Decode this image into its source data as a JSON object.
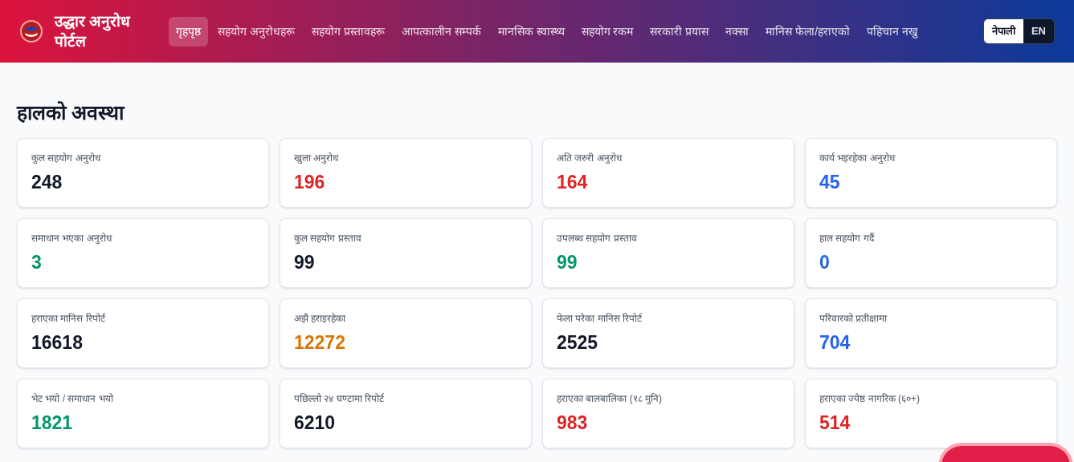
{
  "header": {
    "title": "उद्धार अनुरोध पोर्टल",
    "nav": [
      {
        "label": "गृहपृष्ठ",
        "selected": true
      },
      {
        "label": "सहयोग अनुरोधहरू",
        "selected": false
      },
      {
        "label": "सहयोग प्रस्तावहरू",
        "selected": false
      },
      {
        "label": "आपत्कालीन सम्पर्क",
        "selected": false
      },
      {
        "label": "मानसिक स्वास्थ्य",
        "selected": false
      },
      {
        "label": "सहयोग रकम",
        "selected": false
      },
      {
        "label": "सरकारी प्रयास",
        "selected": false
      },
      {
        "label": "नक्सा",
        "selected": false
      },
      {
        "label": "मानिस फेला/हराएको",
        "selected": false
      },
      {
        "label": "पहिचान नखु",
        "selected": false
      }
    ],
    "languages": [
      {
        "label": "नेपाली",
        "selected": true
      },
      {
        "label": "EN",
        "selected": false
      }
    ]
  },
  "section_title": "हालको अवस्था",
  "stats": [
    {
      "label": "कुल सहयोग अनुरोध",
      "value": "248",
      "color": "#111827"
    },
    {
      "label": "खुला अनुरोध",
      "value": "196",
      "color": "#dc2626"
    },
    {
      "label": "अति जरुरी अनुरोध",
      "value": "164",
      "color": "#dc2626"
    },
    {
      "label": "कार्य भइरहेका अनुरोध",
      "value": "45",
      "color": "#2563eb"
    },
    {
      "label": "समाधान भएका अनुरोध",
      "value": "3",
      "color": "#059669"
    },
    {
      "label": "कुल सहयोग प्रस्ताव",
      "value": "99",
      "color": "#111827"
    },
    {
      "label": "उपलब्ध सहयोग प्रस्ताव",
      "value": "99",
      "color": "#059669"
    },
    {
      "label": "हाल सहयोग गर्दै",
      "value": "0",
      "color": "#2563eb"
    },
    {
      "label": "हराएका मानिस रिपोर्ट",
      "value": "16618",
      "color": "#111827"
    },
    {
      "label": "अझै हराइरहेका",
      "value": "12272",
      "color": "#d97706"
    },
    {
      "label": "फेला परेका मानिस रिपोर्ट",
      "value": "2525",
      "color": "#111827"
    },
    {
      "label": "परिवारको प्रतीक्षामा",
      "value": "704",
      "color": "#2563eb"
    },
    {
      "label": "भेट भयो / समाधान भयो",
      "value": "1821",
      "color": "#059669"
    },
    {
      "label": "पछिल्लो २४ घण्टामा रिपोर्ट",
      "value": "6210",
      "color": "#111827"
    },
    {
      "label": "हराएका बालबालिका (१८ मुनि)",
      "value": "983",
      "color": "#dc2626"
    },
    {
      "label": "हराएका ज्येष्ठ नागरिक (६०+)",
      "value": "514",
      "color": "#dc2626"
    }
  ]
}
